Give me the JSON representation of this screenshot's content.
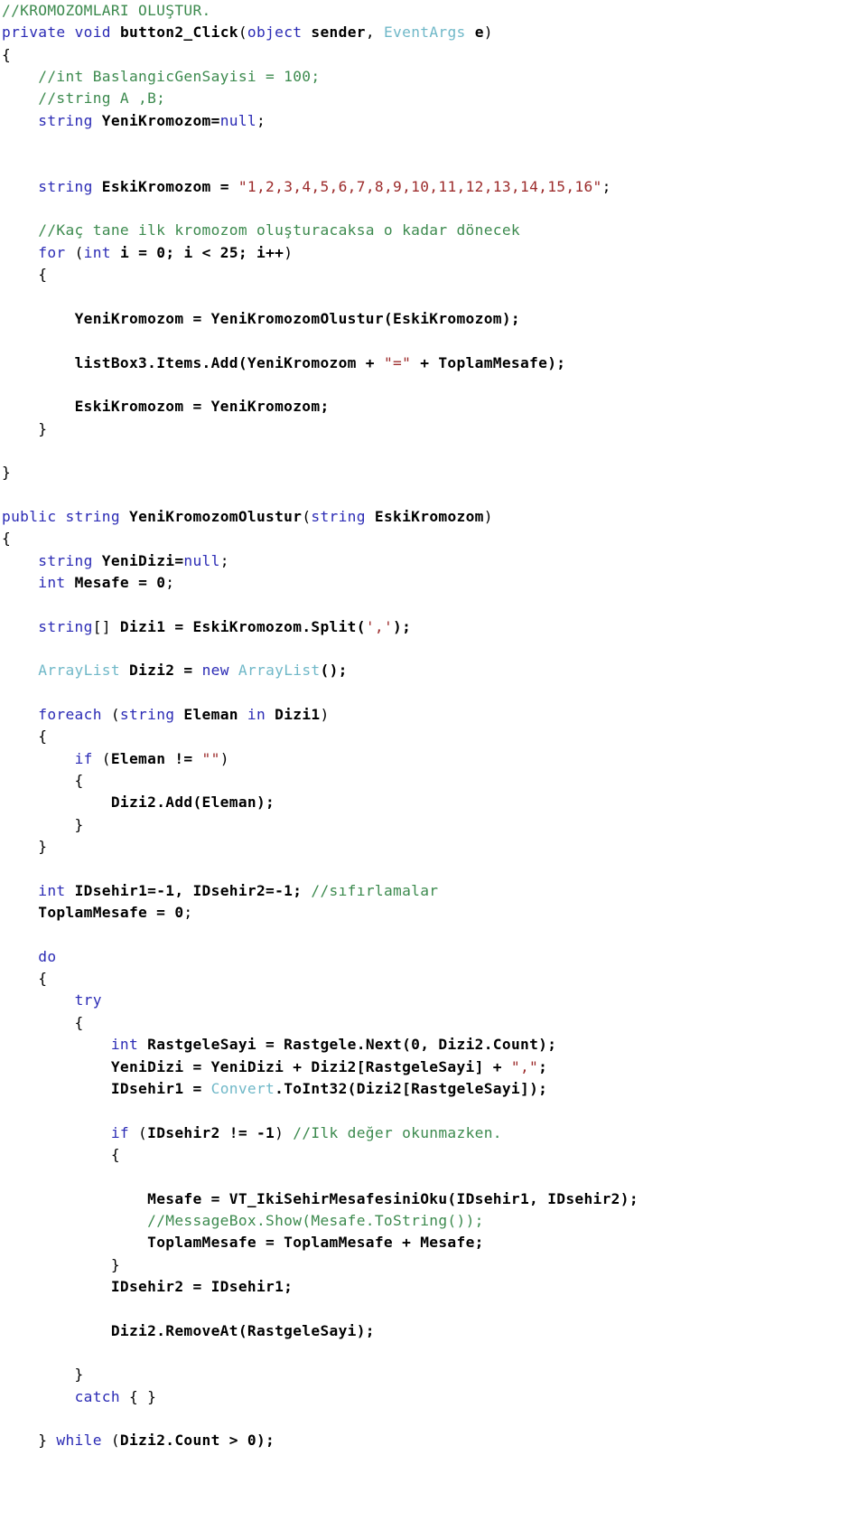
{
  "document": {
    "kind": "source-code-listing",
    "language": "C#",
    "title": "KROMOZOMLARI OLUSTUR",
    "background_color": "#ffffff",
    "colors": {
      "keyword": "#2b2bb5",
      "type": "#70b8c8",
      "comment": "#3c8a4e",
      "string": "#9c2b2b",
      "identifier": "#000000",
      "plain": "#000000"
    }
  },
  "code": {
    "lines": [
      {
        "n": 1,
        "tokens": [
          {
            "t": "//KROMOZOMLARI OLUŞTUR.",
            "c": "cmt"
          }
        ]
      },
      {
        "n": 2,
        "tokens": [
          {
            "t": "private",
            "c": "kw"
          },
          {
            "t": " ",
            "c": "pl"
          },
          {
            "t": "void",
            "c": "kw"
          },
          {
            "t": " ",
            "c": "pl"
          },
          {
            "t": "button2_Click",
            "c": "id"
          },
          {
            "t": "(",
            "c": "pl"
          },
          {
            "t": "object",
            "c": "kw"
          },
          {
            "t": " ",
            "c": "pl"
          },
          {
            "t": "sender",
            "c": "id"
          },
          {
            "t": ", ",
            "c": "pl"
          },
          {
            "t": "EventArgs",
            "c": "typ"
          },
          {
            "t": " ",
            "c": "pl"
          },
          {
            "t": "e",
            "c": "id"
          },
          {
            "t": ")",
            "c": "pl"
          }
        ]
      },
      {
        "n": 3,
        "tokens": [
          {
            "t": "{",
            "c": "pl"
          }
        ]
      },
      {
        "n": 4,
        "tokens": [
          {
            "t": "    ",
            "c": "pl"
          },
          {
            "t": "//int BaslangicGenSayisi = 100;",
            "c": "cmt"
          }
        ]
      },
      {
        "n": 5,
        "tokens": [
          {
            "t": "    ",
            "c": "pl"
          },
          {
            "t": "//string A ,B;",
            "c": "cmt"
          }
        ]
      },
      {
        "n": 6,
        "tokens": [
          {
            "t": "    ",
            "c": "pl"
          },
          {
            "t": "string",
            "c": "kw"
          },
          {
            "t": " ",
            "c": "pl"
          },
          {
            "t": "YeniKromozom",
            "c": "id"
          },
          {
            "t": "=",
            "c": "id"
          },
          {
            "t": "null",
            "c": "kw"
          },
          {
            "t": ";",
            "c": "pl"
          }
        ]
      },
      {
        "n": 7,
        "tokens": []
      },
      {
        "n": 8,
        "tokens": []
      },
      {
        "n": 9,
        "tokens": [
          {
            "t": "    ",
            "c": "pl"
          },
          {
            "t": "string",
            "c": "kw"
          },
          {
            "t": " ",
            "c": "pl"
          },
          {
            "t": "EskiKromozom",
            "c": "id"
          },
          {
            "t": " = ",
            "c": "id"
          },
          {
            "t": "\"1,2,3,4,5,6,7,8,9,10,11,12,13,14,15,16\"",
            "c": "str"
          },
          {
            "t": ";",
            "c": "pl"
          }
        ]
      },
      {
        "n": 10,
        "tokens": []
      },
      {
        "n": 11,
        "tokens": [
          {
            "t": "    ",
            "c": "pl"
          },
          {
            "t": "//Kaç tane ilk kromozom oluşturacaksa o kadar dönecek",
            "c": "cmt"
          }
        ]
      },
      {
        "n": 12,
        "tokens": [
          {
            "t": "    ",
            "c": "pl"
          },
          {
            "t": "for",
            "c": "kw"
          },
          {
            "t": " (",
            "c": "pl"
          },
          {
            "t": "int",
            "c": "kw"
          },
          {
            "t": " ",
            "c": "pl"
          },
          {
            "t": "i",
            "c": "id"
          },
          {
            "t": " = ",
            "c": "id"
          },
          {
            "t": "0",
            "c": "num"
          },
          {
            "t": "; ",
            "c": "id"
          },
          {
            "t": "i",
            "c": "id"
          },
          {
            "t": " < ",
            "c": "id"
          },
          {
            "t": "25",
            "c": "num"
          },
          {
            "t": "; ",
            "c": "id"
          },
          {
            "t": "i++",
            "c": "id"
          },
          {
            "t": ")",
            "c": "pl"
          }
        ]
      },
      {
        "n": 13,
        "tokens": [
          {
            "t": "    {",
            "c": "pl"
          }
        ]
      },
      {
        "n": 14,
        "tokens": []
      },
      {
        "n": 15,
        "tokens": [
          {
            "t": "        ",
            "c": "pl"
          },
          {
            "t": "YeniKromozom = YeniKromozomOlustur(EskiKromozom);",
            "c": "id"
          }
        ]
      },
      {
        "n": 16,
        "tokens": []
      },
      {
        "n": 17,
        "tokens": [
          {
            "t": "        ",
            "c": "pl"
          },
          {
            "t": "listBox3.Items.Add(YeniKromozom + ",
            "c": "id"
          },
          {
            "t": "\"=\"",
            "c": "str"
          },
          {
            "t": " + ToplamMesafe);",
            "c": "id"
          }
        ]
      },
      {
        "n": 18,
        "tokens": []
      },
      {
        "n": 19,
        "tokens": [
          {
            "t": "        ",
            "c": "pl"
          },
          {
            "t": "EskiKromozom = YeniKromozom;",
            "c": "id"
          }
        ]
      },
      {
        "n": 20,
        "tokens": [
          {
            "t": "    }",
            "c": "pl"
          }
        ]
      },
      {
        "n": 21,
        "tokens": []
      },
      {
        "n": 22,
        "tokens": [
          {
            "t": "}",
            "c": "pl"
          }
        ]
      },
      {
        "n": 23,
        "tokens": []
      },
      {
        "n": 24,
        "tokens": [
          {
            "t": "public",
            "c": "kw"
          },
          {
            "t": " ",
            "c": "pl"
          },
          {
            "t": "string",
            "c": "kw"
          },
          {
            "t": " ",
            "c": "pl"
          },
          {
            "t": "YeniKromozomOlustur",
            "c": "id"
          },
          {
            "t": "(",
            "c": "pl"
          },
          {
            "t": "string",
            "c": "kw"
          },
          {
            "t": " ",
            "c": "pl"
          },
          {
            "t": "EskiKromozom",
            "c": "id"
          },
          {
            "t": ")",
            "c": "pl"
          }
        ]
      },
      {
        "n": 25,
        "tokens": [
          {
            "t": "{",
            "c": "pl"
          }
        ]
      },
      {
        "n": 26,
        "tokens": [
          {
            "t": "    ",
            "c": "pl"
          },
          {
            "t": "string",
            "c": "kw"
          },
          {
            "t": " ",
            "c": "pl"
          },
          {
            "t": "YeniDizi",
            "c": "id"
          },
          {
            "t": "=",
            "c": "id"
          },
          {
            "t": "null",
            "c": "kw"
          },
          {
            "t": ";",
            "c": "pl"
          }
        ]
      },
      {
        "n": 27,
        "tokens": [
          {
            "t": "    ",
            "c": "pl"
          },
          {
            "t": "int",
            "c": "kw"
          },
          {
            "t": " ",
            "c": "pl"
          },
          {
            "t": "Mesafe",
            "c": "id"
          },
          {
            "t": " = ",
            "c": "id"
          },
          {
            "t": "0",
            "c": "num"
          },
          {
            "t": ";",
            "c": "pl"
          }
        ]
      },
      {
        "n": 28,
        "tokens": []
      },
      {
        "n": 29,
        "tokens": [
          {
            "t": "    ",
            "c": "pl"
          },
          {
            "t": "string",
            "c": "kw"
          },
          {
            "t": "[] ",
            "c": "pl"
          },
          {
            "t": "Dizi1",
            "c": "id"
          },
          {
            "t": " = EskiKromozom.Split(",
            "c": "id"
          },
          {
            "t": "','",
            "c": "str"
          },
          {
            "t": ");",
            "c": "id"
          }
        ]
      },
      {
        "n": 30,
        "tokens": []
      },
      {
        "n": 31,
        "tokens": [
          {
            "t": "    ",
            "c": "pl"
          },
          {
            "t": "ArrayList",
            "c": "typ"
          },
          {
            "t": " ",
            "c": "pl"
          },
          {
            "t": "Dizi2",
            "c": "id"
          },
          {
            "t": " = ",
            "c": "id"
          },
          {
            "t": "new",
            "c": "kw"
          },
          {
            "t": " ",
            "c": "pl"
          },
          {
            "t": "ArrayList",
            "c": "typ"
          },
          {
            "t": "();",
            "c": "id"
          }
        ]
      },
      {
        "n": 32,
        "tokens": []
      },
      {
        "n": 33,
        "tokens": [
          {
            "t": "    ",
            "c": "pl"
          },
          {
            "t": "foreach",
            "c": "kw"
          },
          {
            "t": " (",
            "c": "pl"
          },
          {
            "t": "string",
            "c": "kw"
          },
          {
            "t": " ",
            "c": "pl"
          },
          {
            "t": "Eleman",
            "c": "id"
          },
          {
            "t": " ",
            "c": "pl"
          },
          {
            "t": "in",
            "c": "kw"
          },
          {
            "t": " ",
            "c": "pl"
          },
          {
            "t": "Dizi1",
            "c": "id"
          },
          {
            "t": ")",
            "c": "pl"
          }
        ]
      },
      {
        "n": 34,
        "tokens": [
          {
            "t": "    {",
            "c": "pl"
          }
        ]
      },
      {
        "n": 35,
        "tokens": [
          {
            "t": "        ",
            "c": "pl"
          },
          {
            "t": "if",
            "c": "kw"
          },
          {
            "t": " (",
            "c": "pl"
          },
          {
            "t": "Eleman",
            "c": "id"
          },
          {
            "t": " != ",
            "c": "id"
          },
          {
            "t": "\"\"",
            "c": "str"
          },
          {
            "t": ")",
            "c": "pl"
          }
        ]
      },
      {
        "n": 36,
        "tokens": [
          {
            "t": "        {",
            "c": "pl"
          }
        ]
      },
      {
        "n": 37,
        "tokens": [
          {
            "t": "            ",
            "c": "pl"
          },
          {
            "t": "Dizi2.Add(Eleman);",
            "c": "id"
          }
        ]
      },
      {
        "n": 38,
        "tokens": [
          {
            "t": "        }",
            "c": "pl"
          }
        ]
      },
      {
        "n": 39,
        "tokens": [
          {
            "t": "    }",
            "c": "pl"
          }
        ]
      },
      {
        "n": 40,
        "tokens": []
      },
      {
        "n": 41,
        "tokens": [
          {
            "t": "    ",
            "c": "pl"
          },
          {
            "t": "int",
            "c": "kw"
          },
          {
            "t": " ",
            "c": "pl"
          },
          {
            "t": "IDsehir1=-1, IDsehir2=-1;",
            "c": "id"
          },
          {
            "t": " ",
            "c": "pl"
          },
          {
            "t": "//sıfırlamalar",
            "c": "cmt"
          }
        ]
      },
      {
        "n": 42,
        "tokens": [
          {
            "t": "    ",
            "c": "pl"
          },
          {
            "t": "ToplamMesafe = ",
            "c": "id"
          },
          {
            "t": "0",
            "c": "num"
          },
          {
            "t": ";",
            "c": "pl"
          }
        ]
      },
      {
        "n": 43,
        "tokens": []
      },
      {
        "n": 44,
        "tokens": [
          {
            "t": "    ",
            "c": "pl"
          },
          {
            "t": "do",
            "c": "kw"
          }
        ]
      },
      {
        "n": 45,
        "tokens": [
          {
            "t": "    {",
            "c": "pl"
          }
        ]
      },
      {
        "n": 46,
        "tokens": [
          {
            "t": "        ",
            "c": "pl"
          },
          {
            "t": "try",
            "c": "kw"
          }
        ]
      },
      {
        "n": 47,
        "tokens": [
          {
            "t": "        {",
            "c": "pl"
          }
        ]
      },
      {
        "n": 48,
        "tokens": [
          {
            "t": "            ",
            "c": "pl"
          },
          {
            "t": "int",
            "c": "kw"
          },
          {
            "t": " ",
            "c": "pl"
          },
          {
            "t": "RastgeleSayi = Rastgele.Next(",
            "c": "id"
          },
          {
            "t": "0",
            "c": "num"
          },
          {
            "t": ", Dizi2.Count);",
            "c": "id"
          }
        ]
      },
      {
        "n": 49,
        "tokens": [
          {
            "t": "            ",
            "c": "pl"
          },
          {
            "t": "YeniDizi = YeniDizi + Dizi2[RastgeleSayi] + ",
            "c": "id"
          },
          {
            "t": "\",\"",
            "c": "str"
          },
          {
            "t": ";",
            "c": "id"
          }
        ]
      },
      {
        "n": 50,
        "tokens": [
          {
            "t": "            ",
            "c": "pl"
          },
          {
            "t": "IDsehir1 = ",
            "c": "id"
          },
          {
            "t": "Convert",
            "c": "typ"
          },
          {
            "t": ".ToInt32(Dizi2[RastgeleSayi]);",
            "c": "id"
          }
        ]
      },
      {
        "n": 51,
        "tokens": []
      },
      {
        "n": 52,
        "tokens": [
          {
            "t": "            ",
            "c": "pl"
          },
          {
            "t": "if",
            "c": "kw"
          },
          {
            "t": " (",
            "c": "pl"
          },
          {
            "t": "IDsehir2",
            "c": "id"
          },
          {
            "t": " != ",
            "c": "id"
          },
          {
            "t": "-1",
            "c": "num"
          },
          {
            "t": ") ",
            "c": "pl"
          },
          {
            "t": "//Ilk değer okunmazken.",
            "c": "cmt"
          }
        ]
      },
      {
        "n": 53,
        "tokens": [
          {
            "t": "            {",
            "c": "pl"
          }
        ]
      },
      {
        "n": 54,
        "tokens": []
      },
      {
        "n": 55,
        "tokens": [
          {
            "t": "                ",
            "c": "pl"
          },
          {
            "t": "Mesafe = VT_IkiSehirMesafesiniOku(IDsehir1, IDsehir2);",
            "c": "id"
          }
        ]
      },
      {
        "n": 56,
        "tokens": [
          {
            "t": "                ",
            "c": "pl"
          },
          {
            "t": "//MessageBox.Show(Mesafe.ToString());",
            "c": "cmt"
          }
        ]
      },
      {
        "n": 57,
        "tokens": [
          {
            "t": "                ",
            "c": "pl"
          },
          {
            "t": "ToplamMesafe = ToplamMesafe + Mesafe;",
            "c": "id"
          }
        ]
      },
      {
        "n": 58,
        "tokens": [
          {
            "t": "            }",
            "c": "pl"
          }
        ]
      },
      {
        "n": 59,
        "tokens": [
          {
            "t": "            ",
            "c": "pl"
          },
          {
            "t": "IDsehir2 = IDsehir1;",
            "c": "id"
          }
        ]
      },
      {
        "n": 60,
        "tokens": []
      },
      {
        "n": 61,
        "tokens": [
          {
            "t": "            ",
            "c": "pl"
          },
          {
            "t": "Dizi2.RemoveAt(RastgeleSayi);",
            "c": "id"
          }
        ]
      },
      {
        "n": 62,
        "tokens": []
      },
      {
        "n": 63,
        "tokens": [
          {
            "t": "        }",
            "c": "pl"
          }
        ]
      },
      {
        "n": 64,
        "tokens": [
          {
            "t": "        ",
            "c": "pl"
          },
          {
            "t": "catch",
            "c": "kw"
          },
          {
            "t": " { }",
            "c": "pl"
          }
        ]
      },
      {
        "n": 65,
        "tokens": []
      },
      {
        "n": 66,
        "tokens": [
          {
            "t": "    } ",
            "c": "pl"
          },
          {
            "t": "while",
            "c": "kw"
          },
          {
            "t": " (",
            "c": "pl"
          },
          {
            "t": "Dizi2.Count > ",
            "c": "id"
          },
          {
            "t": "0",
            "c": "num"
          },
          {
            "t": ");",
            "c": "id"
          }
        ]
      }
    ]
  }
}
